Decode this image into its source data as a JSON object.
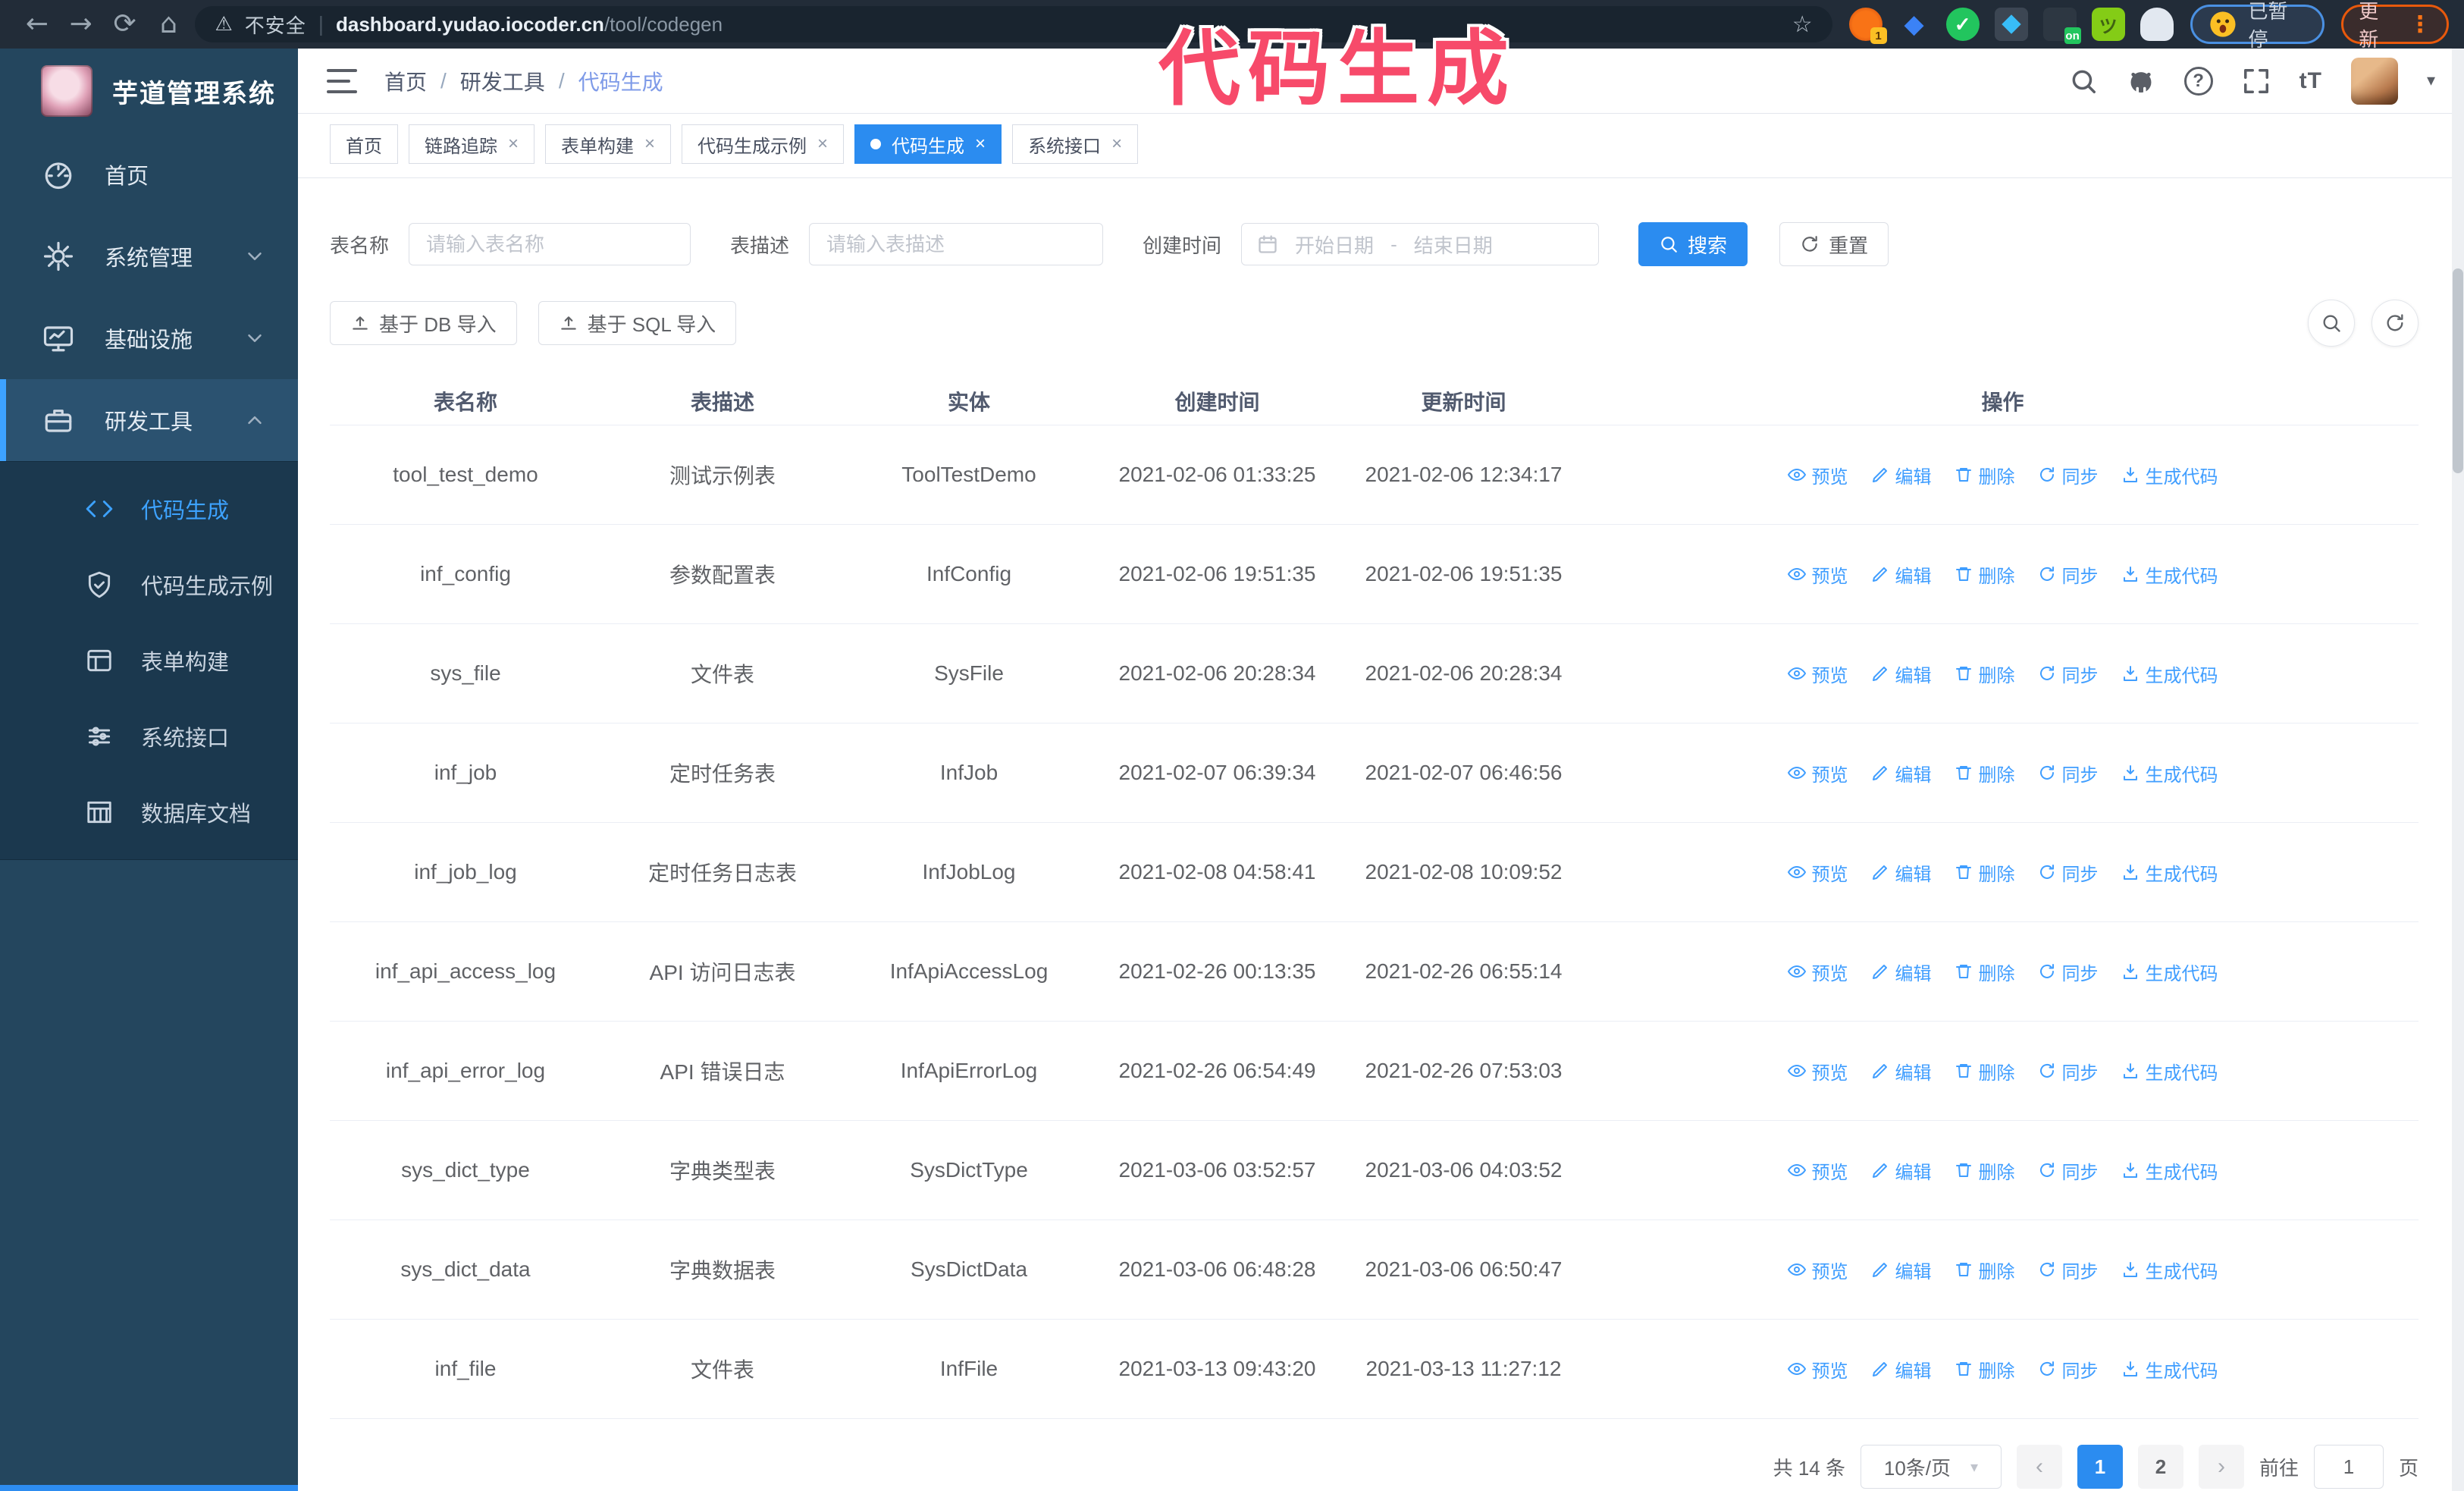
{
  "colors": {
    "accent": "#2b8cf0",
    "link": "#409eff",
    "sidebar_bg": "#24465e",
    "submenu_bg": "#1b384e",
    "annotation": "#f74a6a"
  },
  "annotation": {
    "text": "代码生成"
  },
  "browser": {
    "security_label": "不安全",
    "divider": "|",
    "url_host": "dashboard.yudao.iocoder.cn",
    "url_path": "/tool/codegen",
    "ext_badge_count": "1",
    "ext_badge_on": "on",
    "profile_status": "已暂停",
    "update_label": "更新",
    "icons": {
      "back": "←",
      "forward": "→",
      "reload": "⟳",
      "home": "⌂",
      "warning": "⚠",
      "star": "☆",
      "kebab": "⋮",
      "gem": "◆",
      "check": "✓",
      "droid": "ツ"
    }
  },
  "sidebar": {
    "logo_title": "芋道管理系统",
    "items": [
      {
        "label": "首页"
      },
      {
        "label": "系统管理"
      },
      {
        "label": "基础设施"
      },
      {
        "label": "研发工具"
      }
    ],
    "submenu": [
      {
        "label": "代码生成"
      },
      {
        "label": "代码生成示例"
      },
      {
        "label": "表单构建"
      },
      {
        "label": "系统接口"
      },
      {
        "label": "数据库文档"
      }
    ]
  },
  "header": {
    "breadcrumb": [
      {
        "label": "首页"
      },
      {
        "label": "研发工具"
      },
      {
        "label": "代码生成"
      }
    ],
    "separator": "/",
    "help_glyph": "?",
    "font_icon_label": "tT",
    "caret": "▾"
  },
  "tags": [
    {
      "label": "首页"
    },
    {
      "label": "链路追踪",
      "close": "×"
    },
    {
      "label": "表单构建",
      "close": "×"
    },
    {
      "label": "代码生成示例",
      "close": "×"
    },
    {
      "label": "代码生成",
      "close": "×"
    },
    {
      "label": "系统接口",
      "close": "×"
    }
  ],
  "filters": {
    "table_name_label": "表名称",
    "table_name_placeholder": "请输入表名称",
    "table_desc_label": "表描述",
    "table_desc_placeholder": "请输入表描述",
    "create_time_label": "创建时间",
    "start_placeholder": "开始日期",
    "range_separator": "-",
    "end_placeholder": "结束日期",
    "search_label": "搜索",
    "reset_label": "重置"
  },
  "toolbar": {
    "import_db_label": "基于 DB 导入",
    "import_sql_label": "基于 SQL 导入"
  },
  "table": {
    "columns": [
      "表名称",
      "表描述",
      "实体",
      "创建时间",
      "更新时间",
      "操作"
    ],
    "actions": {
      "preview": "预览",
      "edit": "编辑",
      "delete": "删除",
      "sync": "同步",
      "generate": "生成代码"
    },
    "rows": [
      [
        "tool_test_demo",
        "测试示例表",
        "ToolTestDemo",
        "2021-02-06 01:33:25",
        "2021-02-06 12:34:17"
      ],
      [
        "inf_config",
        "参数配置表",
        "InfConfig",
        "2021-02-06 19:51:35",
        "2021-02-06 19:51:35"
      ],
      [
        "sys_file",
        "文件表",
        "SysFile",
        "2021-02-06 20:28:34",
        "2021-02-06 20:28:34"
      ],
      [
        "inf_job",
        "定时任务表",
        "InfJob",
        "2021-02-07 06:39:34",
        "2021-02-07 06:46:56"
      ],
      [
        "inf_job_log",
        "定时任务日志表",
        "InfJobLog",
        "2021-02-08 04:58:41",
        "2021-02-08 10:09:52"
      ],
      [
        "inf_api_access_log",
        "API 访问日志表",
        "InfApiAccessLog",
        "2021-02-26 00:13:35",
        "2021-02-26 06:55:14"
      ],
      [
        "inf_api_error_log",
        "API 错误日志",
        "InfApiErrorLog",
        "2021-02-26 06:54:49",
        "2021-02-26 07:53:03"
      ],
      [
        "sys_dict_type",
        "字典类型表",
        "SysDictType",
        "2021-03-06 03:52:57",
        "2021-03-06 04:03:52"
      ],
      [
        "sys_dict_data",
        "字典数据表",
        "SysDictData",
        "2021-03-06 06:48:28",
        "2021-03-06 06:50:47"
      ],
      [
        "inf_file",
        "文件表",
        "InfFile",
        "2021-03-13 09:43:20",
        "2021-03-13 11:27:12"
      ]
    ]
  },
  "pagination": {
    "total": "共 14 条",
    "page_size": "10条/页",
    "caret": "▾",
    "prev": "‹",
    "next": "›",
    "pages": [
      "1",
      "2"
    ],
    "goto_label": "前往",
    "goto_value": "1",
    "unit_label": "页"
  }
}
